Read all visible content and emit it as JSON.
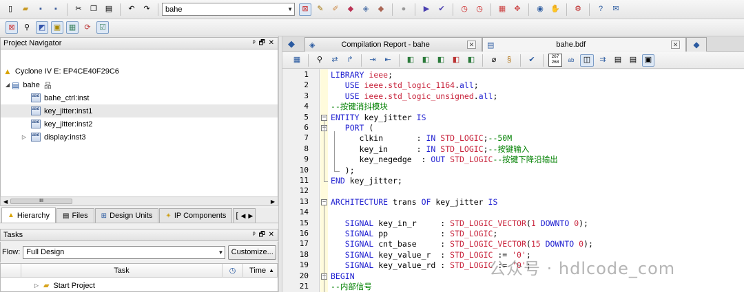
{
  "toolbar": {
    "project_combo": "bahe"
  },
  "navigator": {
    "title": "Project Navigator",
    "pane_controls": "ᵖ 🗗 ✕",
    "device": "Cyclone IV E: EP4CE40F29C6",
    "root": "bahe",
    "root_badge": "品",
    "chip_text": "abd",
    "instances": [
      "bahe_ctrl:inst",
      "key_jitter:inst1",
      "key_jitter:inst2",
      "display:inst3"
    ],
    "scroll_thumb": "III",
    "tabs": [
      "Hierarchy",
      "Files",
      "Design Units",
      "IP Components"
    ],
    "tabs_more": "["
  },
  "tasks": {
    "title": "Tasks",
    "flow_label": "Flow:",
    "flow_value": "Full Design",
    "customize_label": "Customize...",
    "col_task": "Task",
    "col_time": "Time",
    "first_item": "Start Project"
  },
  "editor": {
    "tabs": [
      {
        "label": "Compilation Report - bahe"
      },
      {
        "label": "bahe.bdf"
      }
    ],
    "tab_close": "✕",
    "toolbar_chip": "267\n268",
    "lines": [
      {
        "n": "1",
        "segs": [
          {
            "c": "kw",
            "t": "LIBRARY"
          },
          {
            "c": "",
            "t": " "
          },
          {
            "c": "ty",
            "t": "ieee"
          },
          {
            "c": "",
            "t": ";"
          }
        ]
      },
      {
        "n": "2",
        "segs": [
          {
            "c": "",
            "t": "   "
          },
          {
            "c": "kw",
            "t": "USE"
          },
          {
            "c": "",
            "t": " "
          },
          {
            "c": "ty",
            "t": "ieee.std_logic_1164"
          },
          {
            "c": "",
            "t": "."
          },
          {
            "c": "kw",
            "t": "all"
          },
          {
            "c": "",
            "t": ";"
          }
        ]
      },
      {
        "n": "3",
        "segs": [
          {
            "c": "",
            "t": "   "
          },
          {
            "c": "kw",
            "t": "USE"
          },
          {
            "c": "",
            "t": " "
          },
          {
            "c": "ty",
            "t": "ieee.std_logic_unsigned"
          },
          {
            "c": "",
            "t": "."
          },
          {
            "c": "kw",
            "t": "all"
          },
          {
            "c": "",
            "t": ";"
          }
        ]
      },
      {
        "n": "4",
        "segs": [
          {
            "c": "cm",
            "t": "--按键消抖模块"
          }
        ]
      },
      {
        "n": "5",
        "segs": [
          {
            "c": "kw",
            "t": "ENTITY"
          },
          {
            "c": "",
            "t": " key_jitter "
          },
          {
            "c": "kw",
            "t": "IS"
          }
        ]
      },
      {
        "n": "6",
        "segs": [
          {
            "c": "",
            "t": "   "
          },
          {
            "c": "kw",
            "t": "PORT"
          },
          {
            "c": "",
            "t": " ("
          }
        ]
      },
      {
        "n": "7",
        "segs": [
          {
            "c": "",
            "t": "      clkin       : "
          },
          {
            "c": "kw",
            "t": "IN"
          },
          {
            "c": "",
            "t": " "
          },
          {
            "c": "ty",
            "t": "STD_LOGIC"
          },
          {
            "c": "",
            "t": ";"
          },
          {
            "c": "cm",
            "t": "--50M"
          }
        ]
      },
      {
        "n": "8",
        "segs": [
          {
            "c": "",
            "t": "      key_in      : "
          },
          {
            "c": "kw",
            "t": "IN"
          },
          {
            "c": "",
            "t": " "
          },
          {
            "c": "ty",
            "t": "STD_LOGIC"
          },
          {
            "c": "",
            "t": ";"
          },
          {
            "c": "cm",
            "t": "--按键输入"
          }
        ]
      },
      {
        "n": "9",
        "segs": [
          {
            "c": "",
            "t": "      key_negedge  : "
          },
          {
            "c": "kw",
            "t": "OUT"
          },
          {
            "c": "",
            "t": " "
          },
          {
            "c": "ty",
            "t": "STD_LOGIC"
          },
          {
            "c": "cm",
            "t": "--按键下降沿输出"
          }
        ]
      },
      {
        "n": "10",
        "segs": [
          {
            "c": "",
            "t": "   );"
          }
        ]
      },
      {
        "n": "11",
        "segs": [
          {
            "c": "kw",
            "t": "END"
          },
          {
            "c": "",
            "t": " key_jitter;"
          }
        ]
      },
      {
        "n": "12",
        "segs": []
      },
      {
        "n": "13",
        "segs": [
          {
            "c": "kw",
            "t": "ARCHITECTURE"
          },
          {
            "c": "",
            "t": " trans "
          },
          {
            "c": "kw",
            "t": "OF"
          },
          {
            "c": "",
            "t": " key_jitter "
          },
          {
            "c": "kw",
            "t": "IS"
          }
        ]
      },
      {
        "n": "14",
        "segs": []
      },
      {
        "n": "15",
        "segs": [
          {
            "c": "",
            "t": "   "
          },
          {
            "c": "kw",
            "t": "SIGNAL"
          },
          {
            "c": "",
            "t": " key_in_r     : "
          },
          {
            "c": "ty",
            "t": "STD_LOGIC_VECTOR"
          },
          {
            "c": "",
            "t": "("
          },
          {
            "c": "ty",
            "t": "1"
          },
          {
            "c": "",
            "t": " "
          },
          {
            "c": "kw",
            "t": "DOWNTO"
          },
          {
            "c": "",
            "t": " "
          },
          {
            "c": "ty",
            "t": "0"
          },
          {
            "c": "",
            "t": ");"
          }
        ]
      },
      {
        "n": "16",
        "segs": [
          {
            "c": "",
            "t": "   "
          },
          {
            "c": "kw",
            "t": "SIGNAL"
          },
          {
            "c": "",
            "t": " pp           : "
          },
          {
            "c": "ty",
            "t": "STD_LOGIC"
          },
          {
            "c": "",
            "t": ";"
          }
        ]
      },
      {
        "n": "17",
        "segs": [
          {
            "c": "",
            "t": "   "
          },
          {
            "c": "kw",
            "t": "SIGNAL"
          },
          {
            "c": "",
            "t": " cnt_base     : "
          },
          {
            "c": "ty",
            "t": "STD_LOGIC_VECTOR"
          },
          {
            "c": "",
            "t": "("
          },
          {
            "c": "ty",
            "t": "15"
          },
          {
            "c": "",
            "t": " "
          },
          {
            "c": "kw",
            "t": "DOWNTO"
          },
          {
            "c": "",
            "t": " "
          },
          {
            "c": "ty",
            "t": "0"
          },
          {
            "c": "",
            "t": ");"
          }
        ]
      },
      {
        "n": "18",
        "segs": [
          {
            "c": "",
            "t": "   "
          },
          {
            "c": "kw",
            "t": "SIGNAL"
          },
          {
            "c": "",
            "t": " key_value_r  : "
          },
          {
            "c": "ty",
            "t": "STD_LOGIC"
          },
          {
            "c": "",
            "t": " := "
          },
          {
            "c": "ty",
            "t": "'0'"
          },
          {
            "c": "",
            "t": ";"
          }
        ]
      },
      {
        "n": "19",
        "segs": [
          {
            "c": "",
            "t": "   "
          },
          {
            "c": "kw",
            "t": "SIGNAL"
          },
          {
            "c": "",
            "t": " key_value_rd : "
          },
          {
            "c": "ty",
            "t": "STD_LOGIC"
          },
          {
            "c": "",
            "t": " := "
          },
          {
            "c": "ty",
            "t": "'0'"
          },
          {
            "c": "",
            "t": ";"
          }
        ]
      },
      {
        "n": "20",
        "segs": [
          {
            "c": "kw",
            "t": "BEGIN"
          }
        ]
      },
      {
        "n": "21",
        "segs": [
          {
            "c": "cm",
            "t": "--内部信号"
          }
        ]
      }
    ]
  },
  "watermark": "公众号 · hdlcode_com",
  "colors": {
    "keyword": "#1f1fd0",
    "type": "#c8243c",
    "comment": "#008000",
    "gutter_highlight": "#fffbdc"
  }
}
